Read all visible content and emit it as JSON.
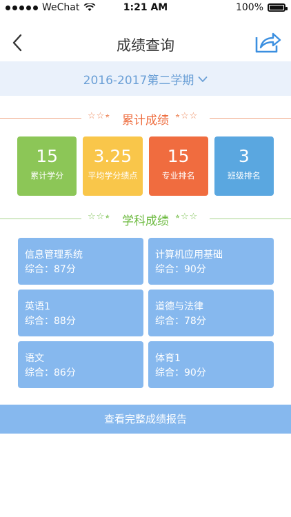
{
  "status_bar": {
    "carrier": "WeChat",
    "time": "1:21 AM",
    "battery": "100%"
  },
  "nav": {
    "title": "成绩查询",
    "back_icon": "chevron-left-icon",
    "share_icon": "share-icon"
  },
  "term_selector": {
    "label": "2016-2017第二学期",
    "icon": "chevron-down-icon"
  },
  "cumulative": {
    "title": "累计成绩",
    "stats": [
      {
        "value": "15",
        "label": "累计学分",
        "color": "#8cc657"
      },
      {
        "value": "3.25",
        "label": "平均学分绩点",
        "color": "#f9c64a"
      },
      {
        "value": "15",
        "label": "专业排名",
        "color": "#f06c3f"
      },
      {
        "value": "3",
        "label": "班级排名",
        "color": "#5aa7e0"
      }
    ]
  },
  "subjects": {
    "title": "学科成绩",
    "items": [
      {
        "name": "信息管理系统",
        "score": "综合：87分"
      },
      {
        "name": "计算机应用基础",
        "score": "综合：90分"
      },
      {
        "name": "英语1",
        "score": "综合：88分"
      },
      {
        "name": "道德与法律",
        "score": "综合：78分"
      },
      {
        "name": "语文",
        "score": "综合：86分"
      },
      {
        "name": "体育1",
        "score": "综合：90分"
      }
    ]
  },
  "report_button": "查看完整成绩报告",
  "colors": {
    "accent_blue": "#86b8ee",
    "term_bg": "#eaf1fb",
    "section1": "#ee6b3c",
    "section2": "#6cba3f"
  }
}
